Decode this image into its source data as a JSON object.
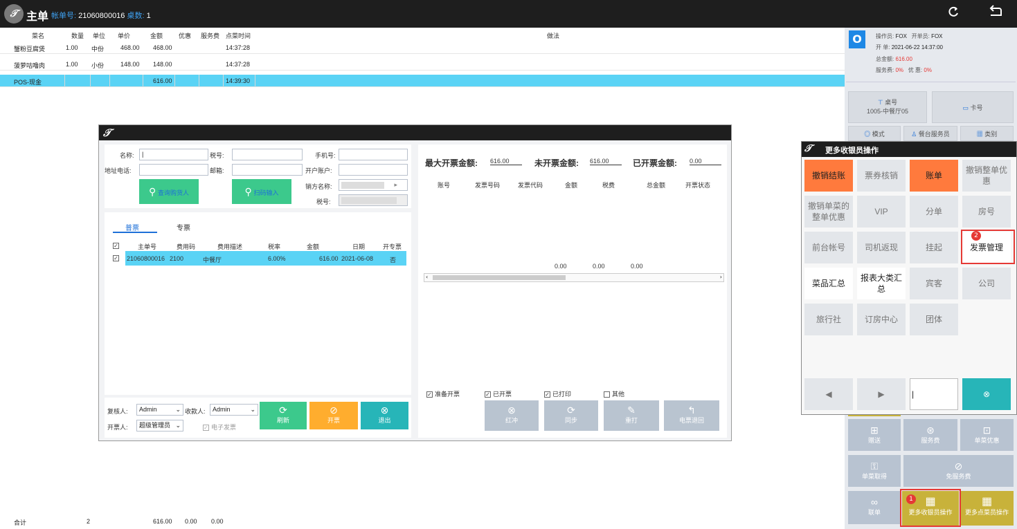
{
  "titlebar": {
    "logo": "𝒯",
    "title": "主单",
    "order_label": "帐单号:",
    "order_no": "21060800016",
    "count_label": "桌数:",
    "count": "1",
    "refresh_icon": "refresh-icon",
    "back_icon": "back-icon"
  },
  "orders": {
    "headers": [
      "菜名",
      "数量",
      "单位",
      "单价",
      "金额",
      "优惠",
      "服务费",
      "点菜时间",
      "做法"
    ],
    "rows": [
      {
        "name": "蟹粉豆腐煲",
        "qty": "1.00",
        "unit": "中份",
        "price": "468.00",
        "amount": "468.00",
        "disc": "",
        "svc": "",
        "time": "14:37:28",
        "method": ""
      },
      {
        "name": "菠萝咕噜肉",
        "qty": "1.00",
        "unit": "小份",
        "price": "148.00",
        "amount": "148.00",
        "disc": "",
        "svc": "",
        "time": "14:37:28",
        "method": ""
      },
      {
        "name": "POS-现金",
        "qty": "",
        "unit": "",
        "price": "",
        "amount": "616.00",
        "disc": "",
        "svc": "",
        "time": "14:39:30",
        "method": ""
      }
    ],
    "totals": {
      "label": "合计",
      "qty": "2",
      "amount": "616.00",
      "disc": "0.00",
      "svc": "0.00"
    }
  },
  "info": {
    "badge": "O",
    "operator_label": "操作员:",
    "operator": "FOX",
    "opener_label": "开单员:",
    "opener": "FOX",
    "open_label": "开 单:",
    "open_time": "2021-06-22 14:37:00",
    "total_label": "总金额:",
    "total": "616.00",
    "svc_label": "服务费:",
    "svc": "0%",
    "disc_label": "优 惠:",
    "disc": "0%"
  },
  "right_buttons": {
    "table_label": "桌号",
    "table_value": "1005-中餐厅05",
    "card": "卡号",
    "mode": "模式",
    "waiter": "餐台服务员",
    "category": "类别",
    "gift": "赠送",
    "service_fee": "服务费",
    "item_discount": "单菜优惠",
    "item_pickup": "单菜取得",
    "free_service": "免服务费",
    "link": "联单",
    "more_cashier": "更多收银员操作",
    "more_order": "更多点菜员操作"
  },
  "invoice_window": {
    "logo": "𝒯",
    "form": {
      "name_label": "名称:",
      "tax_label": "税号:",
      "phone_label": "手机号:",
      "addr_label": "地址电话:",
      "email_label": "邮箱:",
      "account_label": "开户账户:",
      "seller_label": "销方名称:",
      "seller_tax_label": "税号:",
      "query_btn": "查询购货人",
      "scan_btn": "扫码输入"
    },
    "tabs": {
      "normal": "普票",
      "special": "专票"
    },
    "list_headers": [
      "主单号",
      "费用码",
      "费用描述",
      "税率",
      "金额",
      "日期",
      "开专票"
    ],
    "list_rows": [
      {
        "order": "21060800016",
        "code": "2100",
        "desc": "中餐厅",
        "rate": "6.00%",
        "amount": "616.00",
        "date": "2021-06-08",
        "special": "否"
      }
    ],
    "summary": {
      "max_label": "最大开票金额:",
      "max": "616.00",
      "unissued_label": "未开票金额:",
      "unissued": "616.00",
      "issued_label": "已开票金额:",
      "issued": "0.00"
    },
    "record_headers": [
      "账号",
      "发票号码",
      "发票代码",
      "金额",
      "税费",
      "总金额",
      "开票状态"
    ],
    "record_totals": [
      "0.00",
      "0.00",
      "0.00"
    ],
    "filters": [
      "准备开票",
      "已开票",
      "已打印",
      "其他"
    ],
    "reviewer_label": "复核人:",
    "reviewer": "Admin",
    "payee_label": "收款人:",
    "payee": "Admin",
    "issuer_label": "开票人:",
    "issuer": "超级管理员",
    "e_invoice": "电子发票",
    "actions": {
      "refresh": "刷新",
      "issue": "开票",
      "exit": "退出"
    },
    "disabled_actions": {
      "red": "红冲",
      "sync": "同步",
      "reprint": "重打",
      "return": "电票退回"
    }
  },
  "dialog": {
    "logo": "𝒯",
    "title": "更多收银员操作",
    "cells": [
      "撤销结账",
      "票券核销",
      "账单",
      "撤销整单优惠",
      "撤销单菜的整单优惠",
      "VIP",
      "分单",
      "房号",
      "前台帐号",
      "司机返现",
      "挂起",
      "发票管理",
      "菜品汇总",
      "报表大类汇总",
      "宾客",
      "公司",
      "旅行社",
      "订房中心",
      "团体"
    ],
    "markers": {
      "one": "1",
      "two": "2"
    }
  }
}
